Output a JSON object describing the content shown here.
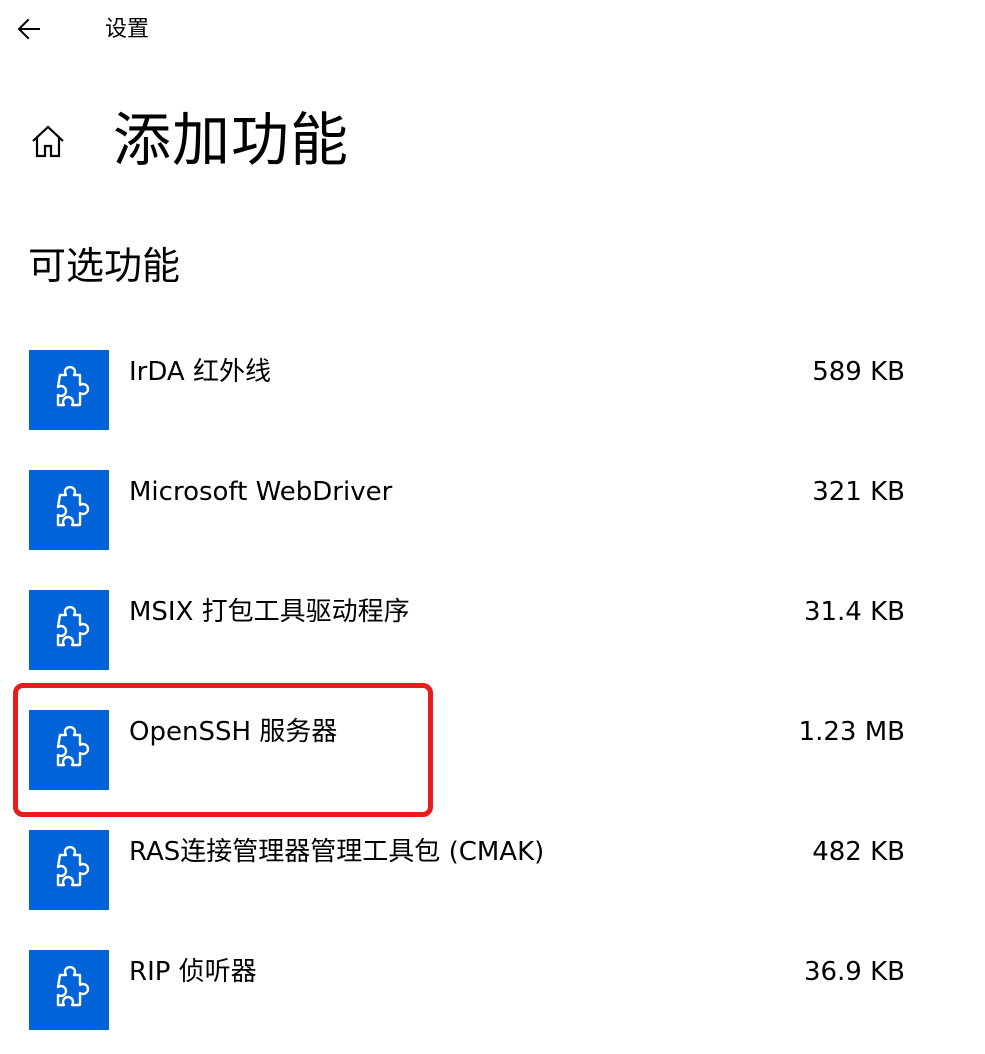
{
  "window": {
    "app_title": "设置",
    "back_icon": "arrow-left-icon"
  },
  "header": {
    "home_icon": "home-icon",
    "page_title": "添加功能"
  },
  "section": {
    "title": "可选功能"
  },
  "features": [
    {
      "name": "IrDA 红外线",
      "size": "589 KB",
      "icon": "puzzle-icon"
    },
    {
      "name": "Microsoft WebDriver",
      "size": "321 KB",
      "icon": "puzzle-icon"
    },
    {
      "name": "MSIX 打包工具驱动程序",
      "size": "31.4 KB",
      "icon": "puzzle-icon"
    },
    {
      "name": "OpenSSH 服务器",
      "size": "1.23 MB",
      "icon": "puzzle-icon",
      "highlighted": true
    },
    {
      "name": "RAS连接管理器管理工具包 (CMAK)",
      "size": "482 KB",
      "icon": "puzzle-icon"
    },
    {
      "name": "RIP 侦听器",
      "size": "36.9 KB",
      "icon": "puzzle-icon"
    }
  ],
  "colors": {
    "tile_accent": "#0063d8",
    "highlight_border": "#e81c1c",
    "background": "#ffffff"
  }
}
